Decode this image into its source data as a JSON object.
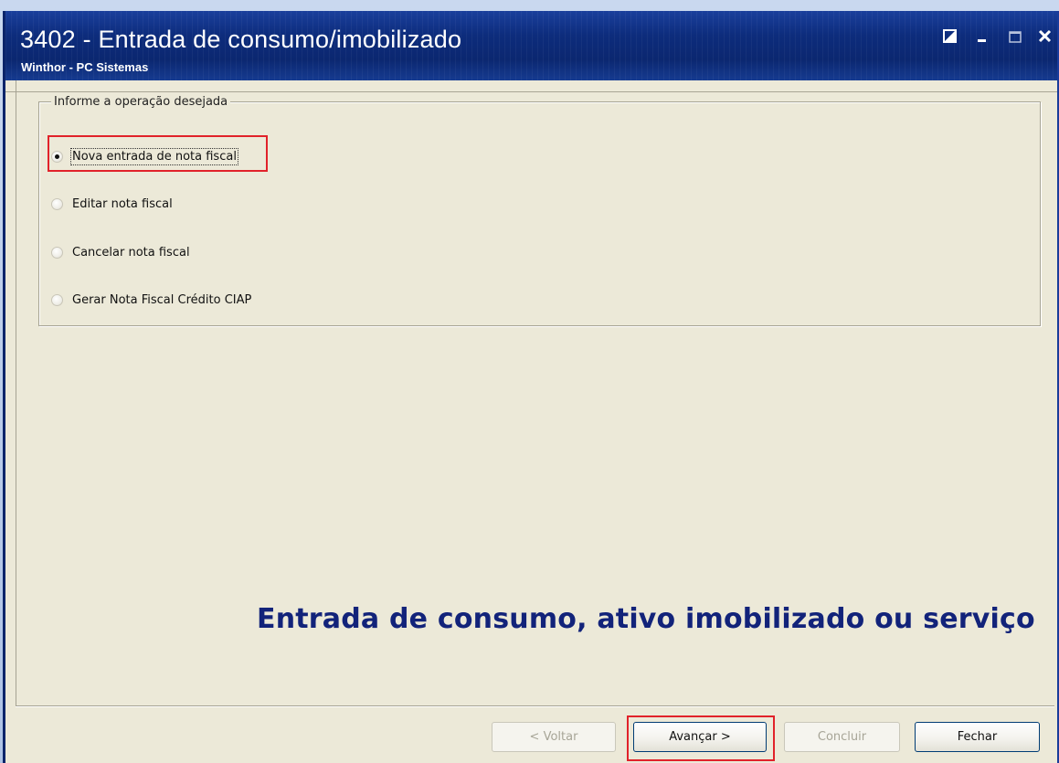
{
  "window": {
    "title": "3402 - Entrada de consumo/imobilizado",
    "subtitle": "Winthor - PC Sistemas",
    "controls": [
      "restore-icon",
      "minimize-icon",
      "maximize-icon",
      "close-icon"
    ]
  },
  "group": {
    "legend": "Informe a operação desejada",
    "options": [
      {
        "label": "Nova entrada de nota fiscal",
        "checked": true
      },
      {
        "label": "Editar nota fiscal",
        "checked": false
      },
      {
        "label": "Cancelar nota fiscal",
        "checked": false
      },
      {
        "label": "Gerar Nota Fiscal Crédito CIAP",
        "checked": false
      }
    ]
  },
  "banner": "Entrada de consumo, ativo imobilizado ou serviço",
  "buttons": {
    "voltar": {
      "label": "< Voltar",
      "enabled": false
    },
    "avancar": {
      "label": "Avançar >",
      "enabled": true
    },
    "concluir": {
      "label": "Concluir",
      "enabled": false
    },
    "fechar": {
      "label": "Fechar",
      "enabled": true
    }
  },
  "colors": {
    "highlight": "#e1222a",
    "banner": "#12237a",
    "titlebar": "#0d2c7c",
    "window_bg": "#ece9d8"
  }
}
